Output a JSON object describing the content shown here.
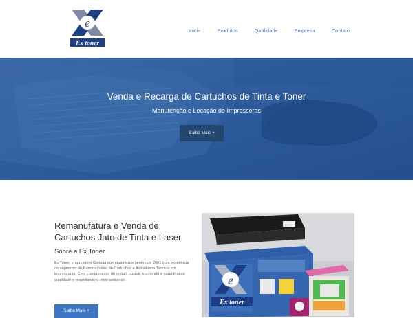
{
  "header": {
    "logo_text": "Ex toner",
    "nav": [
      "Inicio",
      "Produtos",
      "Qualidade",
      "Empresa",
      "Contato"
    ]
  },
  "hero": {
    "title": "Venda e Recarga de Cartuchos de Tinta e Toner",
    "subtitle": "Manutenção e Locação de Impressoras",
    "button": "Saiba Mais +"
  },
  "about": {
    "heading": "Remanufatura e Venda de Cartuchos Jato de Tinta e Laser",
    "subheading": "Sobre a Ex Toner",
    "body": "Ex Toner, empresa de Goiânia que atua desde janeiro de 2001 com excelência no segmento de Remanufatura de Cartuchos e Assistência Técnica em impressoras. Com compromisso de reduzir custos, mantendo e garantindo a qualidade e respeitando o meio ambiente.",
    "button": "Saiba Mais +"
  },
  "photo": {
    "box_logo_text": "Ex toner"
  },
  "colors": {
    "brand_blue": "#2b5a97",
    "nav_link": "#4a7fc1",
    "hero_button": "#24466f",
    "about_button": "#3f76c3"
  }
}
